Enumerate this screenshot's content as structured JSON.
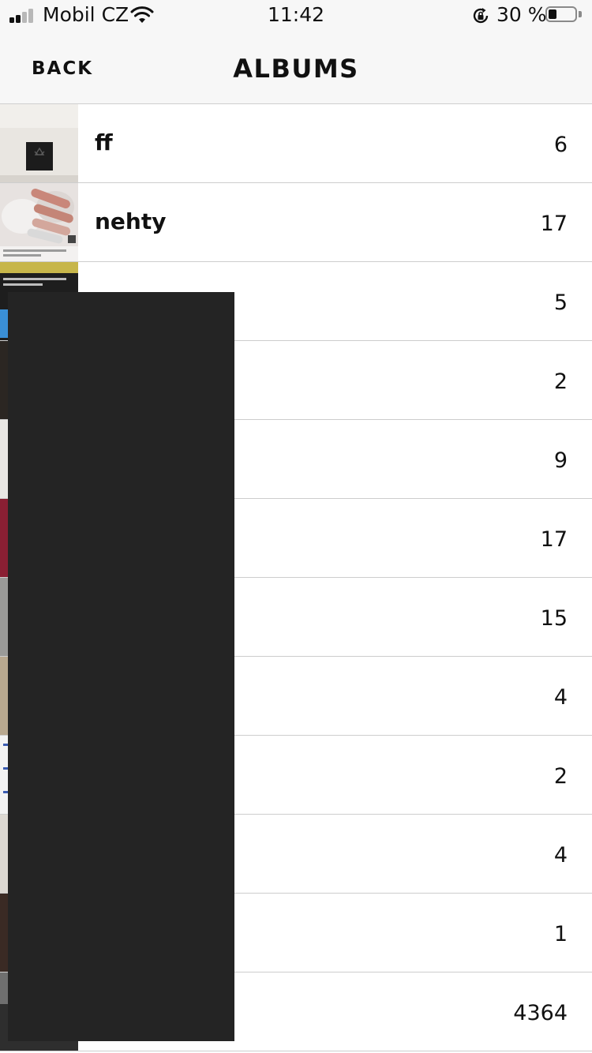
{
  "status_bar": {
    "carrier": "Mobil CZ",
    "time": "11:42",
    "battery_percent": "30 %",
    "battery_level": 0.3,
    "icons": [
      "signal-icon",
      "wifi-icon",
      "rotation-lock-icon",
      "battery-icon"
    ]
  },
  "nav": {
    "back_label": "BACK",
    "title": "ALBUMS"
  },
  "albums": [
    {
      "name": "ff",
      "count": "6",
      "thumb": "thumb-frame-on-wall"
    },
    {
      "name": "nehty",
      "count": "17",
      "thumb": "thumb-nails-photo"
    },
    {
      "name": "",
      "count": "5",
      "thumb": "thumb-screenshot"
    },
    {
      "name": "",
      "count": "2",
      "thumb": "thumb-dark"
    },
    {
      "name": "",
      "count": "9",
      "thumb": "thumb-light"
    },
    {
      "name": "",
      "count": "17",
      "thumb": "thumb-red"
    },
    {
      "name": "",
      "count": "15",
      "thumb": "thumb-grey"
    },
    {
      "name": "",
      "count": "4",
      "thumb": "thumb-beige"
    },
    {
      "name": "",
      "count": "2",
      "thumb": "thumb-document"
    },
    {
      "name": "",
      "count": "4",
      "thumb": "thumb-light"
    },
    {
      "name": "",
      "count": "1",
      "thumb": "thumb-dark-brown"
    },
    {
      "name": "",
      "count": "4364",
      "thumb": "thumb-mixed"
    }
  ],
  "colors": {
    "bar_background": "#f7f7f7",
    "separator": "#cdcdcd",
    "redaction": "#242424"
  }
}
